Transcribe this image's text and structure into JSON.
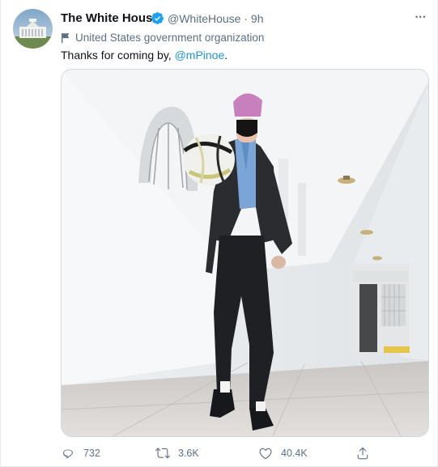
{
  "tweet": {
    "display_name": "The White House",
    "handle": "@WhiteHouse",
    "separator": "·",
    "time_ago": "9h",
    "account_label": "United States government organization",
    "text_prefix": "Thanks for coming by, ",
    "mention": "@mPinoe",
    "text_suffix": ".",
    "more_glyph": "•••"
  },
  "actions": {
    "replies": "732",
    "retweets": "3.6K",
    "likes": "40.4K"
  },
  "icons": {
    "verified": "verified-badge-icon",
    "label": "flag-icon",
    "more": "more-options-icon",
    "reply": "reply-icon",
    "retweet": "retweet-icon",
    "like": "heart-icon",
    "share": "share-icon"
  },
  "colors": {
    "primary_text": "#0f1419",
    "secondary_text": "#5b7083",
    "link": "#1b95e0",
    "verified": "#1da1f2",
    "border": "#cfd9de"
  }
}
